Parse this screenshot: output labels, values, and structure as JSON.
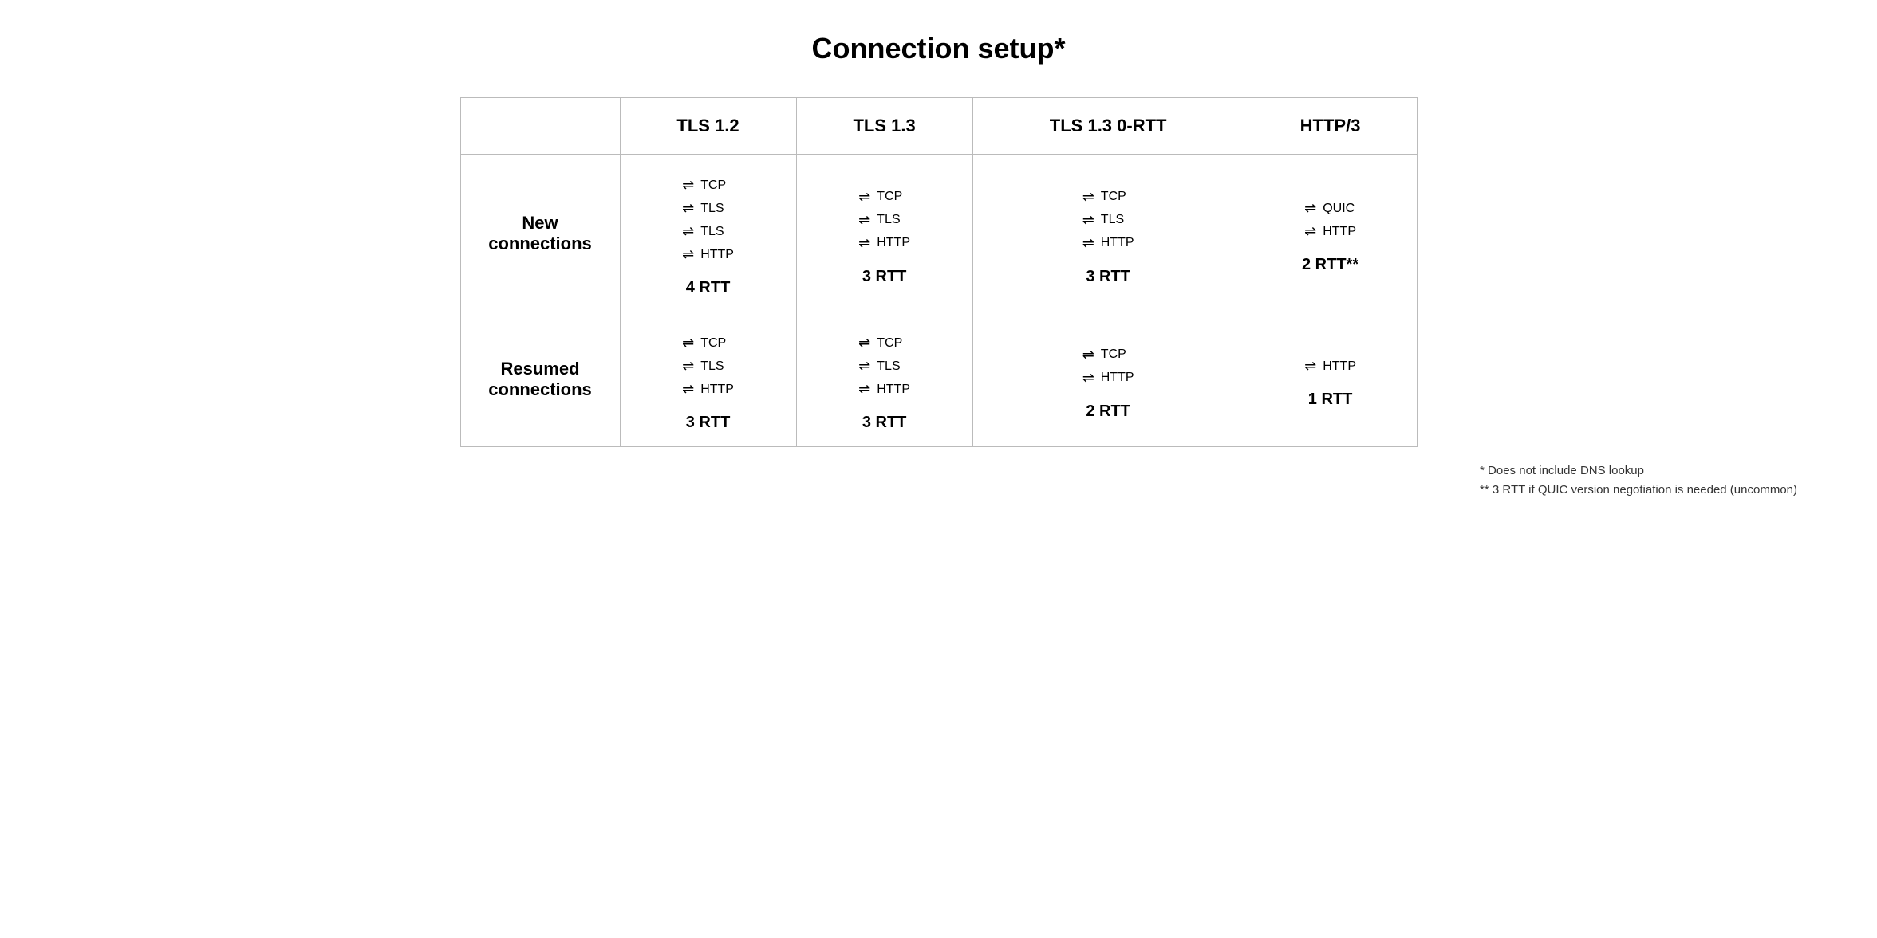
{
  "page": {
    "title": "Connection setup*"
  },
  "table": {
    "headers": [
      "",
      "TLS 1.2",
      "TLS 1.3",
      "TLS 1.3 0-RTT",
      "HTTP/3"
    ],
    "rows": [
      {
        "label_line1": "New",
        "label_line2": "connections",
        "cells": [
          {
            "protocols": [
              "TCP",
              "TLS",
              "TLS",
              "HTTP"
            ],
            "rtt": "4 RTT"
          },
          {
            "protocols": [
              "TCP",
              "TLS",
              "HTTP"
            ],
            "rtt": "3 RTT"
          },
          {
            "protocols": [
              "TCP",
              "TLS",
              "HTTP"
            ],
            "rtt": "3 RTT"
          },
          {
            "protocols": [
              "QUIC",
              "HTTP"
            ],
            "rtt": "2 RTT**"
          }
        ]
      },
      {
        "label_line1": "Resumed",
        "label_line2": "connections",
        "cells": [
          {
            "protocols": [
              "TCP",
              "TLS",
              "HTTP"
            ],
            "rtt": "3 RTT"
          },
          {
            "protocols": [
              "TCP",
              "TLS",
              "HTTP"
            ],
            "rtt": "3 RTT"
          },
          {
            "protocols": [
              "TCP",
              "HTTP"
            ],
            "rtt": "2 RTT"
          },
          {
            "protocols": [
              "HTTP"
            ],
            "rtt": "1 RTT"
          }
        ]
      }
    ],
    "footnotes": [
      "* Does not include DNS lookup",
      "** 3 RTT if QUIC version negotiation is needed (uncommon)"
    ]
  }
}
